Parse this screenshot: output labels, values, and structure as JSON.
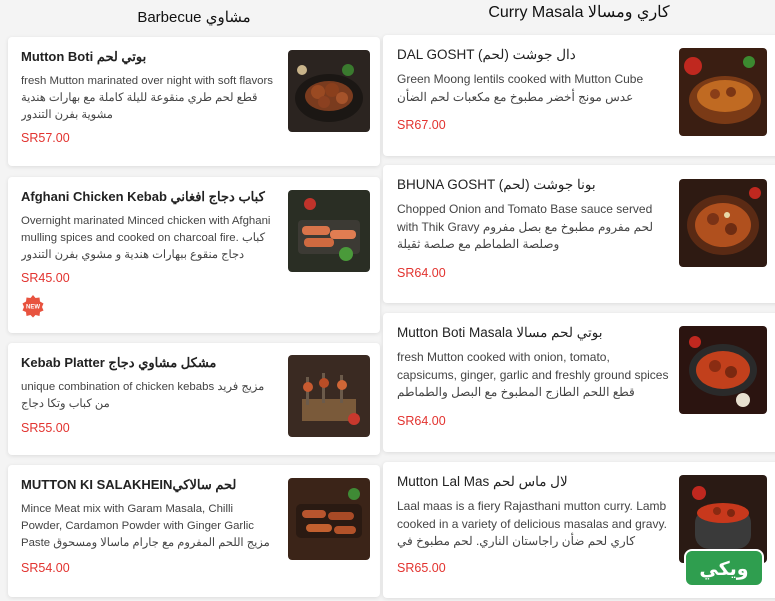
{
  "barbecue": {
    "title": "Barbecue مشاوي",
    "items": [
      {
        "name": "Mutton Boti بوتي لحم",
        "desc": "fresh Mutton marinated over night with soft flavors قطع لحم طري منقوعة لليلة كاملة مع بهارات هندية مشوية بفرن التندور",
        "price": "SR57.00",
        "image": "mutton-boti-photo"
      },
      {
        "name": "Afghani Chicken Kebab كباب دجاج افغاني",
        "desc": "Overnight marinated Minced chicken with Afghani mulling spices and cooked on charcoal fire. كباب دجاج منقوع ببهارات هندية و مشوي بفرن التندور",
        "price": "SR45.00",
        "image": "afghani-chicken-kebab-photo",
        "badge": "NEW"
      },
      {
        "name": "Kebab Platter مشكل مشاوي دجاج",
        "desc": "unique combination of chicken kebabs مزيج فريد من كباب وتكا دجاج",
        "price": "SR55.00",
        "image": "kebab-platter-photo"
      },
      {
        "name": "MUTTON KI SALAKHEINلحم سالاكي",
        "desc": "Mince Meat mix with Garam Masala, Chilli Powder, Cardamon Powder with Ginger Garlic Paste مزيج اللحم المفروم مع جارام ماسالا ومسحوق الفلفل الحار",
        "price": "SR54.00",
        "image": "mutton-ki-salakhein-photo"
      }
    ]
  },
  "curry": {
    "title": "Curry Masala كاري ومسالا",
    "items": [
      {
        "name": "DAL GOSHT (لحم) دال جوشت",
        "desc": "Green Moong lentils cooked with Mutton Cube عدس مونج أخضر مطبوخ مع مكعبات لحم الضأن",
        "price": "SR67.00",
        "image": "dal-gosht-photo"
      },
      {
        "name": "BHUNA GOSHT (لحم) بونا جوشت",
        "desc": "Chopped Onion and Tomato Base sauce served with Thik Gravy لحم مفروم مطبوخ مع بصل مفروم وصلصة الطماطم مع صلصة ثقيلة",
        "price": "SR64.00",
        "image": "bhuna-gosht-photo"
      },
      {
        "name": "Mutton Boti Masala بوتي لحم مسالا",
        "desc": "fresh Mutton cooked with onion, tomato, capsicums, ginger, garlic and freshly ground spices قطع اللحم الطازج المطبوخ مع البصل والطماطم والزنجبيل...",
        "price": "SR64.00",
        "image": "mutton-boti-masala-photo"
      },
      {
        "name": "Mutton Lal Mas لال ماس لحم",
        "desc": "Laal maas is a fiery Rajasthani mutton curry. Lamb cooked in a variety of delicious masalas and gravy. كاري لحم ضأن راجاستان الناري. لحم مطبوخ في مجموعة...",
        "price": "SR65.00",
        "image": "mutton-lal-mas-photo"
      }
    ]
  },
  "watermark": {
    "text": "ويكي"
  },
  "colors": {
    "price": "#e2332f",
    "badge": "#e8533f",
    "watermark": "#2f9e4f"
  }
}
